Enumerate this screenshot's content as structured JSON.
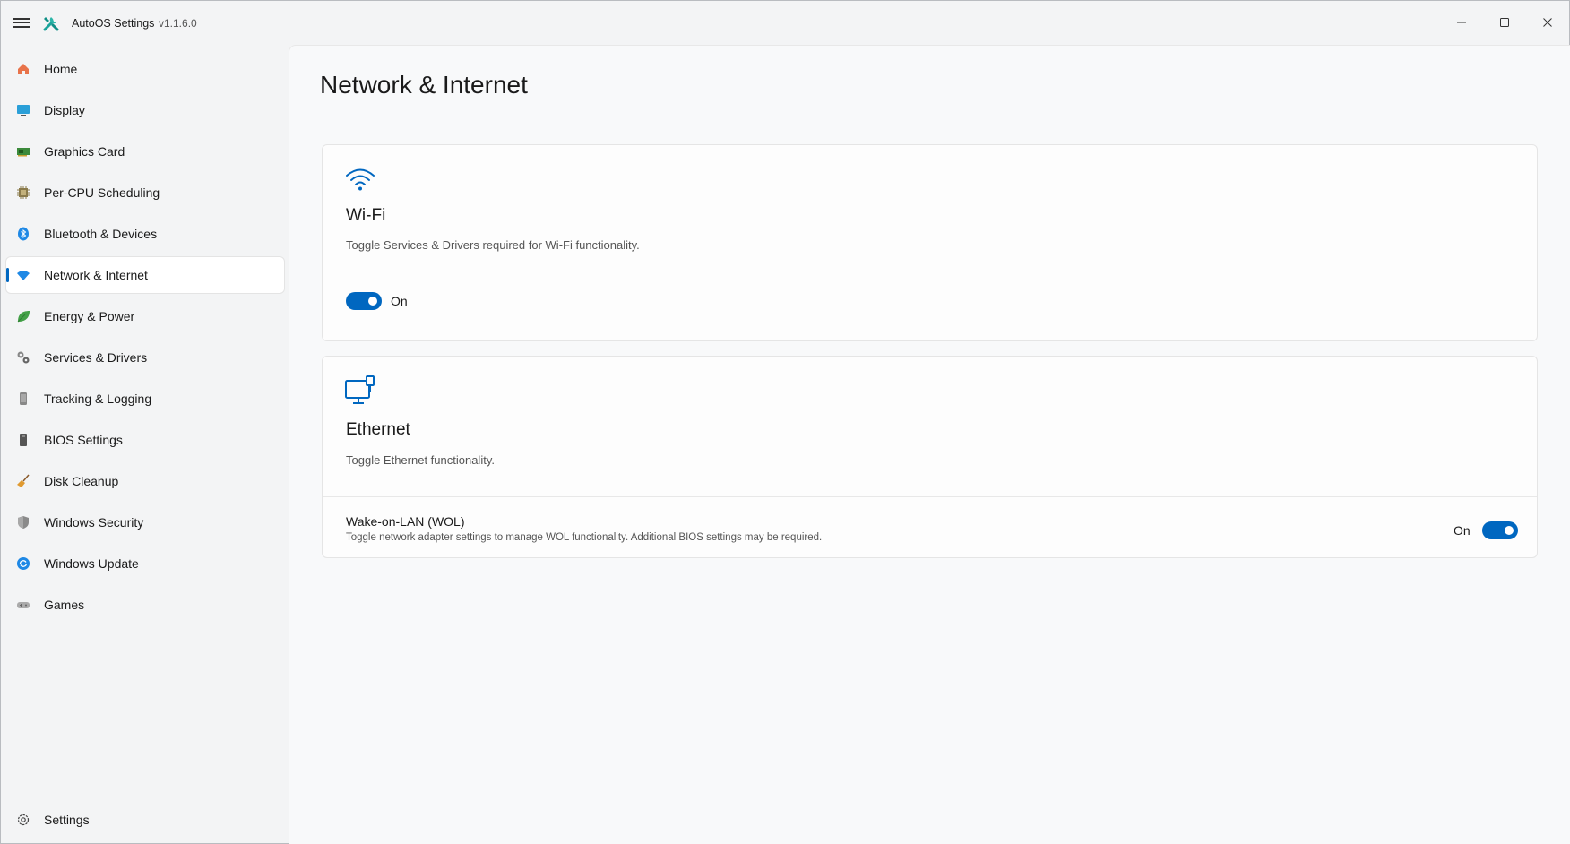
{
  "app": {
    "title": "AutoOS Settings",
    "version": "v1.1.6.0"
  },
  "sidebar": {
    "items": [
      {
        "label": "Home",
        "icon": "home-icon",
        "color": "#e8734a"
      },
      {
        "label": "Display",
        "icon": "display-icon",
        "color": "#2a9fd8"
      },
      {
        "label": "Graphics Card",
        "icon": "graphics-card-icon",
        "color": "#3b8a3b"
      },
      {
        "label": "Per-CPU Scheduling",
        "icon": "cpu-icon",
        "color": "#8a7a4a"
      },
      {
        "label": "Bluetooth & Devices",
        "icon": "bluetooth-icon",
        "color": "#1e88e5"
      },
      {
        "label": "Network & Internet",
        "icon": "wifi-icon",
        "color": "#1e88e5",
        "active": true
      },
      {
        "label": "Energy & Power",
        "icon": "leaf-icon",
        "color": "#43a047"
      },
      {
        "label": "Services & Drivers",
        "icon": "gears-icon",
        "color": "#777777"
      },
      {
        "label": "Tracking & Logging",
        "icon": "tracking-icon",
        "color": "#888888"
      },
      {
        "label": "BIOS Settings",
        "icon": "bios-icon",
        "color": "#555555"
      },
      {
        "label": "Disk Cleanup",
        "icon": "broom-icon",
        "color": "#e09a30"
      },
      {
        "label": "Windows Security",
        "icon": "shield-icon",
        "color": "#8a8a8a"
      },
      {
        "label": "Windows Update",
        "icon": "update-icon",
        "color": "#1e88e5"
      },
      {
        "label": "Games",
        "icon": "gamepad-icon",
        "color": "#999999"
      }
    ],
    "footer": {
      "label": "Settings",
      "icon": "gear-icon"
    }
  },
  "main": {
    "title": "Network & Internet",
    "wifi": {
      "title": "Wi-Fi",
      "description": "Toggle Services & Drivers required for Wi-Fi functionality.",
      "toggle_state": "On"
    },
    "ethernet": {
      "title": "Ethernet",
      "description": "Toggle Ethernet functionality.",
      "wol": {
        "title": "Wake-on-LAN (WOL)",
        "description": "Toggle network adapter settings to manage WOL functionality. Additional BIOS settings may be required.",
        "toggle_state": "On"
      }
    }
  },
  "colors": {
    "accent": "#0067c0"
  }
}
